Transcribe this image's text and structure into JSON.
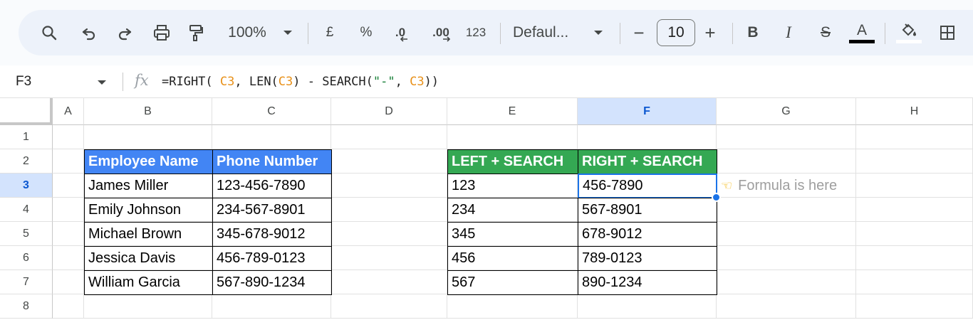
{
  "toolbar": {
    "zoom": "100%",
    "currency": "£",
    "percent": "%",
    "decrease_decimal": ".0",
    "increase_decimal": ".00",
    "number_format": "123",
    "font": "Defaul...",
    "font_size": "10",
    "minus": "−",
    "plus": "+",
    "bold": "B",
    "italic": "I",
    "strike": "S",
    "text_color_letter": "A",
    "text_color": "#000000",
    "fill_color": "#ffffff"
  },
  "formula_bar": {
    "name_box": "F3",
    "fx": "fx",
    "formula_parts": [
      {
        "t": "=RIGHT( ",
        "k": "fn"
      },
      {
        "t": "C3",
        "k": "ref"
      },
      {
        "t": ", LEN(",
        "k": "fn"
      },
      {
        "t": "C3",
        "k": "ref"
      },
      {
        "t": ") - SEARCH(",
        "k": "fn"
      },
      {
        "t": "\"-\"",
        "k": "str"
      },
      {
        "t": ", ",
        "k": "fn"
      },
      {
        "t": "C3",
        "k": "ref"
      },
      {
        "t": "))",
        "k": "fn"
      }
    ]
  },
  "sheet": {
    "columns": [
      "A",
      "B",
      "C",
      "D",
      "E",
      "F",
      "G",
      "H"
    ],
    "selected_column": "F",
    "rows": [
      "1",
      "2",
      "3",
      "4",
      "5",
      "6",
      "7",
      "8"
    ],
    "selected_row": "3",
    "table1": {
      "headers": [
        "Employee Name",
        "Phone Number"
      ],
      "rows": [
        [
          "James Miller",
          "123-456-7890"
        ],
        [
          "Emily Johnson",
          "234-567-8901"
        ],
        [
          "Michael Brown",
          "345-678-9012"
        ],
        [
          "Jessica Davis",
          "456-789-0123"
        ],
        [
          "William Garcia",
          "567-890-1234"
        ]
      ]
    },
    "table2": {
      "headers": [
        "LEFT + SEARCH",
        "RIGHT + SEARCH"
      ],
      "rows": [
        [
          "123",
          "456-7890"
        ],
        [
          "234",
          "567-8901"
        ],
        [
          "345",
          "678-9012"
        ],
        [
          "456",
          "789-0123"
        ],
        [
          "567",
          "890-1234"
        ]
      ]
    },
    "note": "Formula is here",
    "colors": {
      "header_blue": "#4285f4",
      "header_green": "#34a853",
      "selection": "#1a73e8"
    }
  }
}
